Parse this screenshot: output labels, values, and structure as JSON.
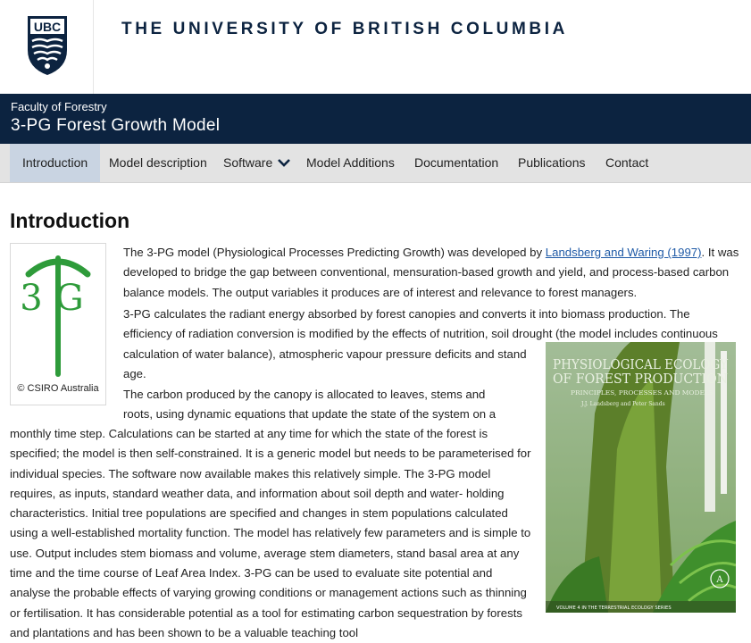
{
  "header": {
    "logo_text": "UBC",
    "university": "THE UNIVERSITY OF BRITISH COLUMBIA"
  },
  "banner": {
    "faculty": "Faculty of Forestry",
    "site_title": "3-PG Forest Growth Model"
  },
  "nav": {
    "items": [
      "Introduction",
      "Model description",
      "Software",
      "Model Additions",
      "Documentation",
      "Publications",
      "Contact"
    ],
    "active": "Introduction"
  },
  "main": {
    "heading": "Introduction",
    "logo_text": "3G",
    "logo_credit": "© CSIRO Australia",
    "book_title": "PHYSIOLOGICAL ECOLOGY OF FOREST PRODUCTION",
    "book_subtitle": "PRINCIPLES, PROCESSES AND MODELS",
    "book_authors": "J.J. Landsberg and Peter Sands",
    "book_series": "VOLUME 4 IN THE TERRESTRIAL ECOLOGY SERIES",
    "p1": {
      "l1_pre": "The 3-PG model (Physiological Processes Predicting Growth) was developed by ",
      "link": "Landsberg and Waring (1997)",
      "l1_post": ". It was",
      "l2": "developed to bridge the gap between conventional, mensuration-based growth and yield, and process-based carbon",
      "l3": "balance models. The output variables it produces are of interest and relevance to forest managers."
    },
    "p2": [
      "3-PG calculates the radiant energy absorbed by forest canopies and converts it into biomass production. The",
      "efficiency of radiation conversion is modified by the effects of nutrition, soil drought (the model includes continuous",
      "calculation of water balance), atmospheric vapour pressure deficits and stand",
      "age."
    ],
    "p3": [
      "The carbon produced by the canopy is allocated to leaves, stems and",
      "roots, using dynamic equations that update the state of the system on a",
      "monthly time step. Calculations can be started at any time for which the state of the forest is",
      "specified; the model is then self-constrained. It is a generic model but needs to be parameterised for",
      "individual species. The software now available makes this relatively simple. The 3-PG model",
      "requires, as inputs, standard weather data, and information about soil depth and water- holding",
      "characteristics. Initial tree populations are specified and changes in stem populations calculated",
      "using a well-established mortality function. The model has relatively few parameters and is simple to",
      "use. Output includes stem biomass and volume, average stem diameters, stand basal area at any",
      "time and the time course of Leaf Area Index. 3-PG can be used to evaluate site potential and",
      "analyse the probable effects of varying growing conditions or management actions such as thinning",
      "or fertilisation. It has considerable potential as a tool for estimating carbon sequestration by forests",
      "and plantations and has been shown to be a valuable teaching tool"
    ]
  },
  "colors": {
    "navy": "#0c2340",
    "nav_bg": "#e3e3e3",
    "nav_active": "#c9d4e2",
    "link": "#1f5aa6",
    "logo_green": "#2e9b3a"
  },
  "icons": {
    "nav_dropdown": "chevron-down-icon",
    "ubc_crest": "ubc-crest-icon"
  }
}
